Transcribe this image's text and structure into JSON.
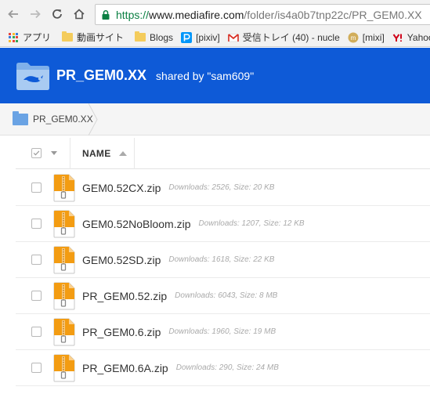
{
  "browser": {
    "url": {
      "scheme": "https://",
      "host": "www.mediafire.com",
      "path": "/folder/is4a0b7tnp22c/PR_GEM0.XX"
    },
    "bookmarks": [
      {
        "label": "アプリ",
        "icon": "apps-grid-icon"
      },
      {
        "label": "動画サイト",
        "icon": "folder-icon"
      },
      {
        "label": "Blogs",
        "icon": "folder-icon"
      },
      {
        "label": "[pixiv]",
        "icon": "pixiv-icon"
      },
      {
        "label": "受信トレイ (40) - nucle",
        "icon": "gmail-icon"
      },
      {
        "label": "[mixi]",
        "icon": "mixi-icon"
      },
      {
        "label": "Yahoo!",
        "icon": "yahoo-icon"
      }
    ]
  },
  "header": {
    "folder_name": "PR_GEM0.XX",
    "shared_by": "shared by \"sam609\""
  },
  "breadcrumb": {
    "label": "PR_GEM0.XX"
  },
  "list": {
    "column_name": "NAME",
    "files": [
      {
        "name": "GEM0.52CX.zip",
        "meta": "Downloads: 2526, Size: 20 KB"
      },
      {
        "name": "GEM0.52NoBloom.zip",
        "meta": "Downloads: 1207, Size: 12 KB"
      },
      {
        "name": "GEM0.52SD.zip",
        "meta": "Downloads: 1618, Size: 22 KB"
      },
      {
        "name": "PR_GEM0.52.zip",
        "meta": "Downloads: 6043, Size: 8 MB"
      },
      {
        "name": "PR_GEM0.6.zip",
        "meta": "Downloads: 1960, Size: 19 MB"
      },
      {
        "name": "PR_GEM0.6A.zip",
        "meta": "Downloads: 290, Size: 24 MB"
      }
    ]
  },
  "colors": {
    "header_bg": "#0e5ad7",
    "url_scheme": "#0b8043",
    "zip_orange": "#f39c12"
  }
}
